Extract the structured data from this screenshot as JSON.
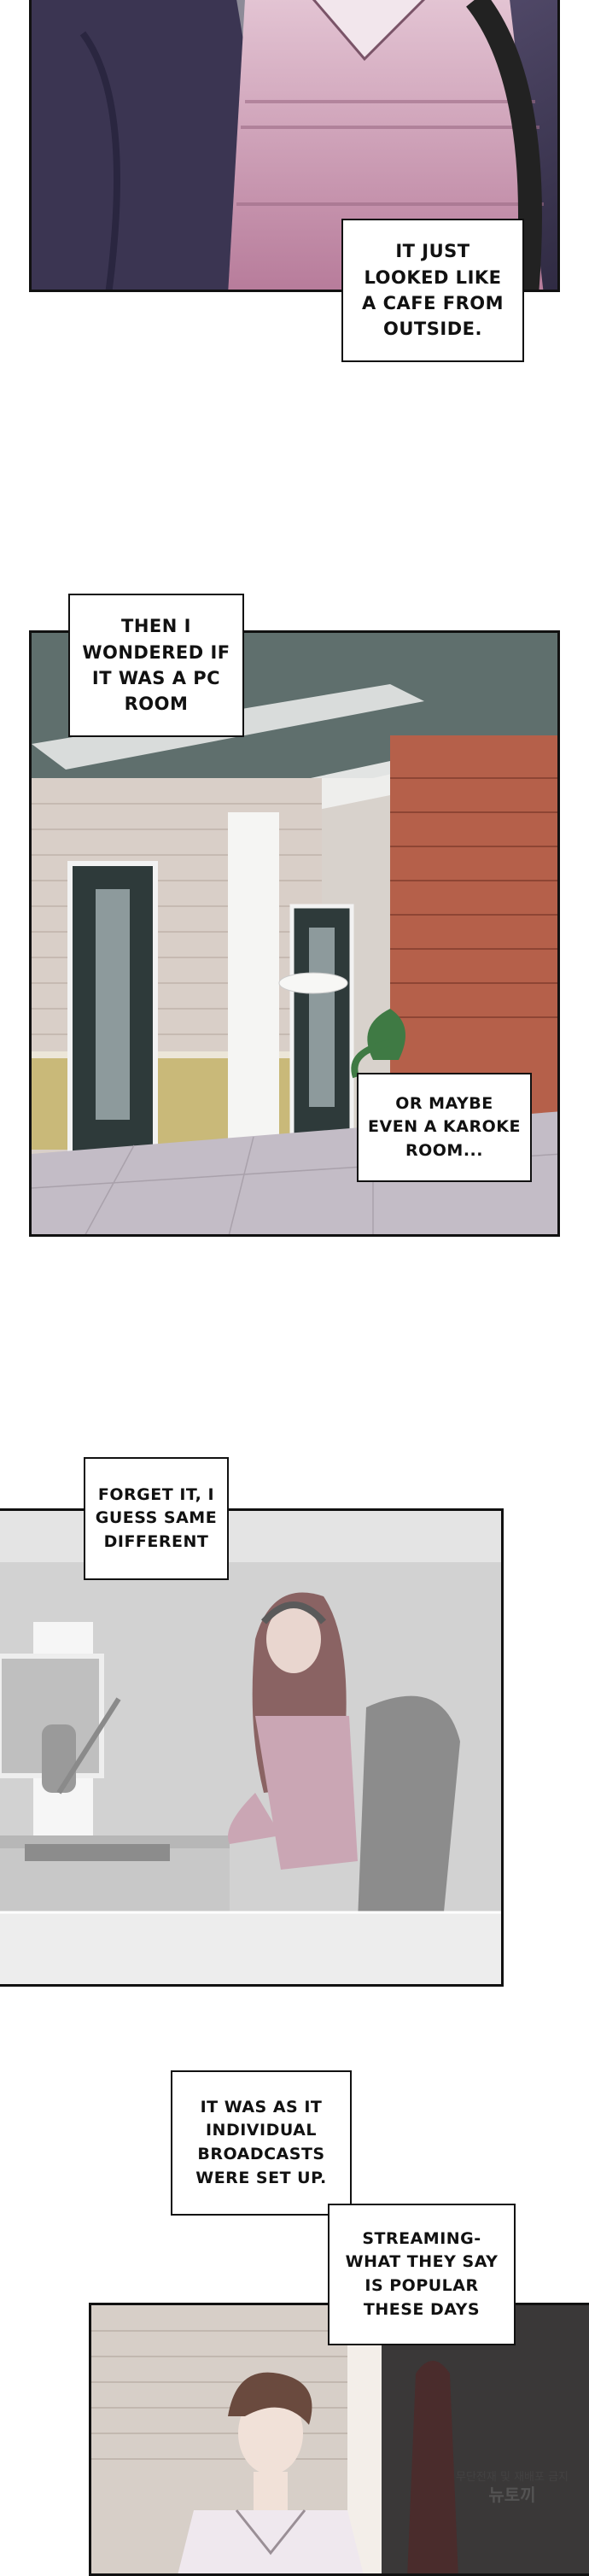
{
  "captions": {
    "cafe": "IT JUST\nLOOKED LIKE\nA CAFE FROM\nOUTSIDE.",
    "pc_room": "THEN I\nWONDERED IF\nIT WAS A PC\nROOM",
    "karaoke": "OR MAYBE\nEVEN A KAROKE\nROOM...",
    "forget": "FORGET IT, I\nGUESS SAME\nDIFFERENT",
    "broadcasts": "IT WAS AS IT\nINDIVIDUAL\nBROADCASTS\nWERE SET UP.",
    "streaming": "STREAMING-\nWHAT THEY SAY\nIS POPULAR\nTHESE DAYS"
  },
  "watermark": {
    "line1": "무단전재 및 재배포 금지",
    "brand": "뉴토끼"
  },
  "colors": {
    "ceiling": "#5f6f6d",
    "brick": "#b5604a",
    "wall_tile": "#d9cfc8",
    "door": "#2e3a3a",
    "sweater": "#d6b3c4",
    "jacket": "#463f5c"
  }
}
